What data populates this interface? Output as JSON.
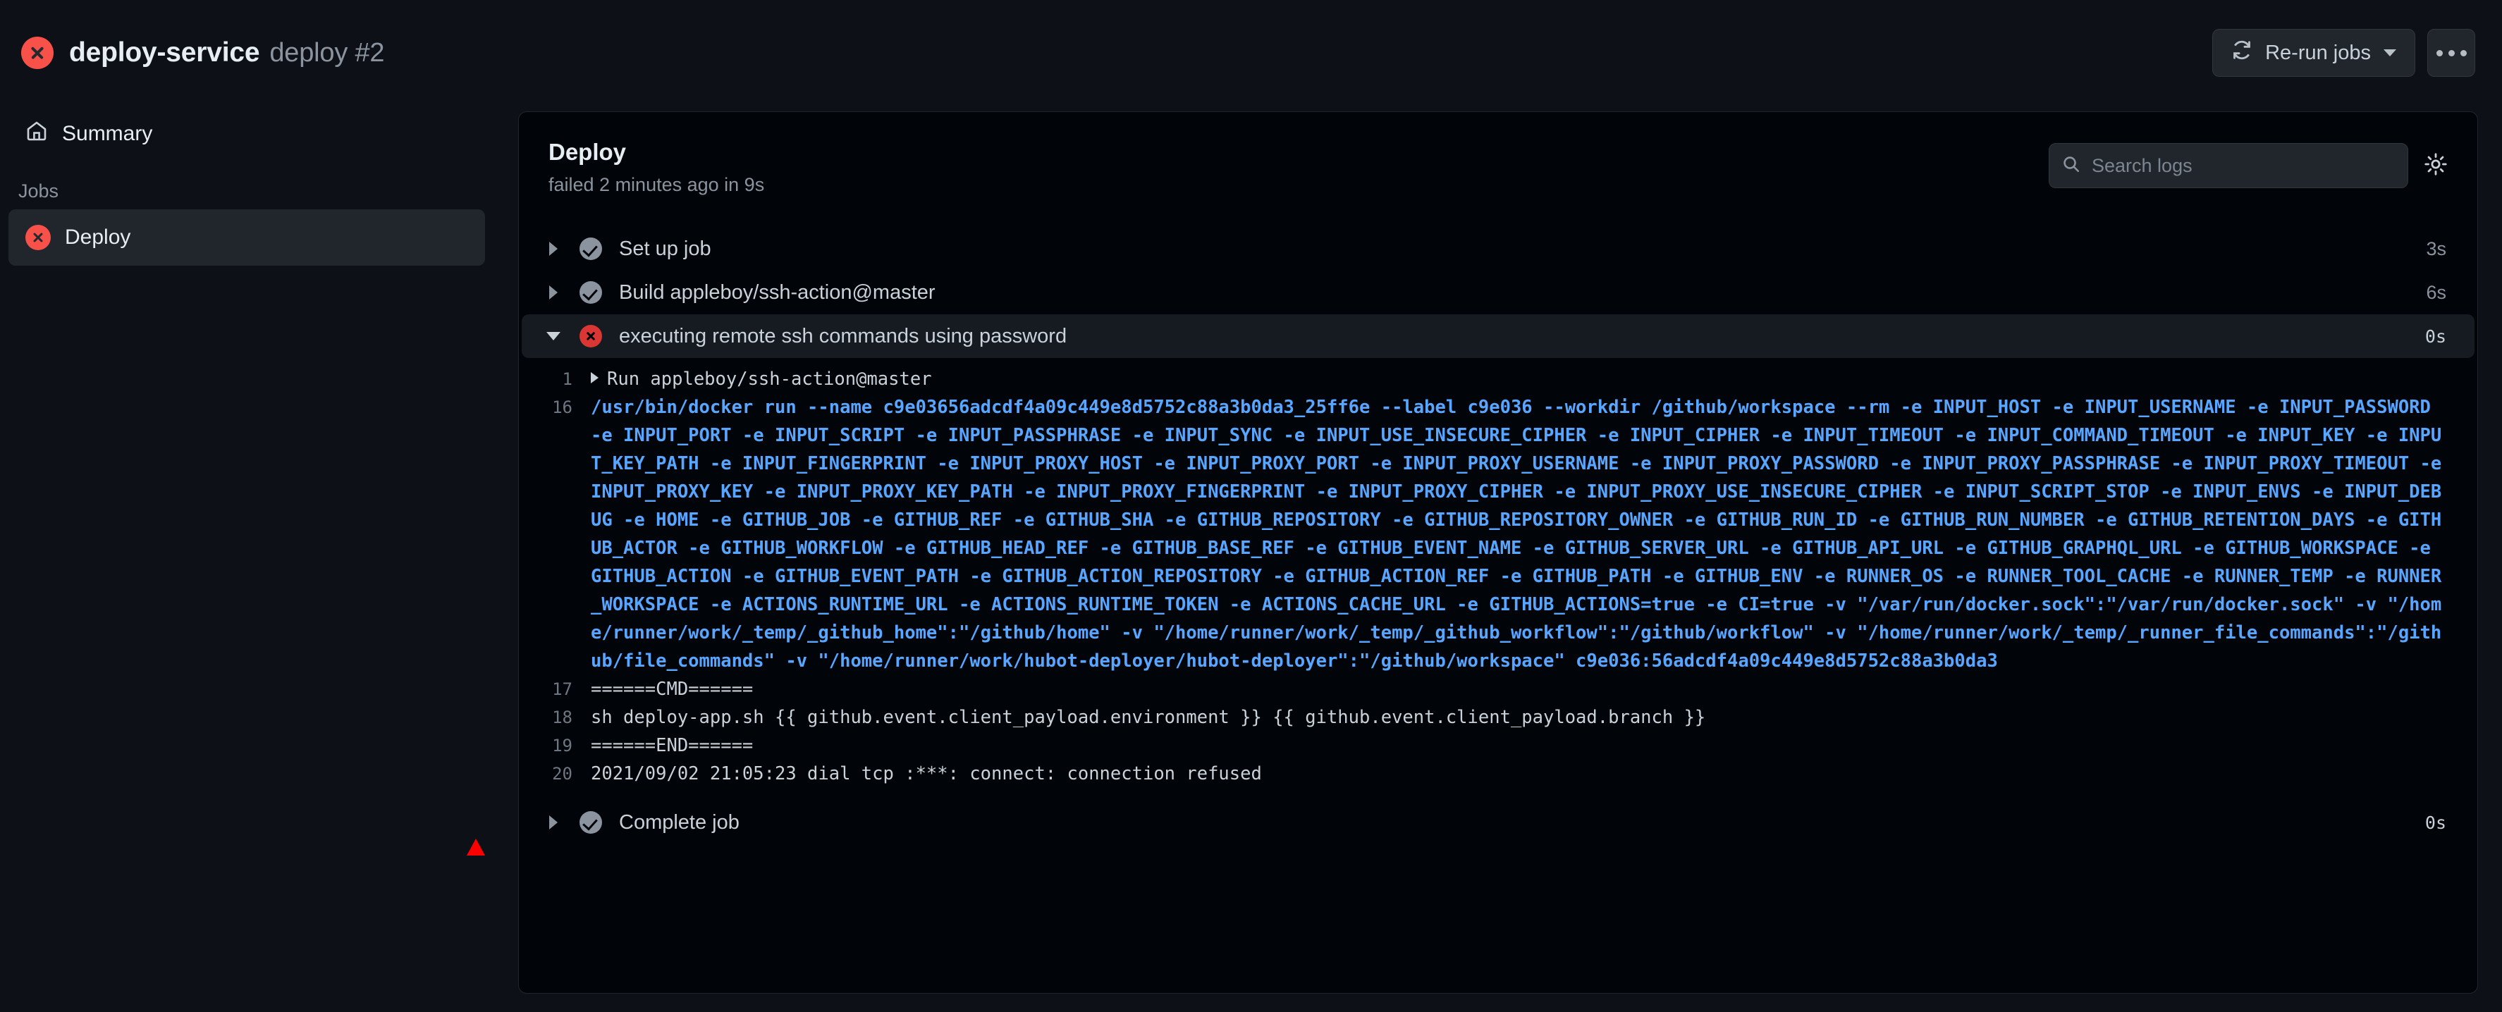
{
  "header": {
    "status_icon": "failure-x-icon",
    "workflow_name": "deploy-service",
    "run_label": "deploy #2",
    "rerun_button": "Re-run jobs",
    "rerun_icon": "refresh-icon",
    "more_button": "…",
    "accent_failure": "#f85149"
  },
  "sidebar": {
    "summary_label": "Summary",
    "summary_icon": "home-icon",
    "jobs_section_label": "Jobs",
    "jobs": [
      {
        "label": "Deploy",
        "status": "failure",
        "selected": true
      }
    ]
  },
  "panel": {
    "job_title": "Deploy",
    "job_status": "failed 2 minutes ago in 9s",
    "search": {
      "placeholder": "Search logs",
      "value": "",
      "icon": "search-icon"
    },
    "settings_icon": "gear-icon",
    "steps": [
      {
        "name": "Set up job",
        "status": "success",
        "duration": "3s",
        "expanded": false
      },
      {
        "name": "Build appleboy/ssh-action@master",
        "status": "success",
        "duration": "6s",
        "expanded": false
      },
      {
        "name": "executing remote ssh commands using password",
        "status": "failure",
        "duration": "0s",
        "expanded": true
      }
    ],
    "complete_step": {
      "name": "Complete job",
      "status": "success",
      "duration": "0s",
      "expanded": false
    },
    "log_lines": [
      {
        "n": "1",
        "style": "gray",
        "prefix": "run-triangle",
        "text": "Run appleboy/ssh-action@master"
      },
      {
        "n": "16",
        "style": "blue",
        "text": "/usr/bin/docker run --name c9e03656adcdf4a09c449e8d5752c88a3b0da3_25ff6e --label c9e036 --workdir /github/workspace --rm -e INPUT_HOST -e INPUT_USERNAME -e INPUT_PASSWORD -e INPUT_PORT -e INPUT_SCRIPT -e INPUT_PASSPHRASE -e INPUT_SYNC -e INPUT_USE_INSECURE_CIPHER -e INPUT_CIPHER -e INPUT_TIMEOUT -e INPUT_COMMAND_TIMEOUT -e INPUT_KEY -e INPUT_KEY_PATH -e INPUT_FINGERPRINT -e INPUT_PROXY_HOST -e INPUT_PROXY_PORT -e INPUT_PROXY_USERNAME -e INPUT_PROXY_PASSWORD -e INPUT_PROXY_PASSPHRASE -e INPUT_PROXY_TIMEOUT -e INPUT_PROXY_KEY -e INPUT_PROXY_KEY_PATH -e INPUT_PROXY_FINGERPRINT -e INPUT_PROXY_CIPHER -e INPUT_PROXY_USE_INSECURE_CIPHER -e INPUT_SCRIPT_STOP -e INPUT_ENVS -e INPUT_DEBUG -e HOME -e GITHUB_JOB -e GITHUB_REF -e GITHUB_SHA -e GITHUB_REPOSITORY -e GITHUB_REPOSITORY_OWNER -e GITHUB_RUN_ID -e GITHUB_RUN_NUMBER -e GITHUB_RETENTION_DAYS -e GITHUB_ACTOR -e GITHUB_WORKFLOW -e GITHUB_HEAD_REF -e GITHUB_BASE_REF -e GITHUB_EVENT_NAME -e GITHUB_SERVER_URL -e GITHUB_API_URL -e GITHUB_GRAPHQL_URL -e GITHUB_WORKSPACE -e GITHUB_ACTION -e GITHUB_EVENT_PATH -e GITHUB_ACTION_REPOSITORY -e GITHUB_ACTION_REF -e GITHUB_PATH -e GITHUB_ENV -e RUNNER_OS -e RUNNER_TOOL_CACHE -e RUNNER_TEMP -e RUNNER_WORKSPACE -e ACTIONS_RUNTIME_URL -e ACTIONS_RUNTIME_TOKEN -e ACTIONS_CACHE_URL -e GITHUB_ACTIONS=true -e CI=true -v \"/var/run/docker.sock\":\"/var/run/docker.sock\" -v \"/home/runner/work/_temp/_github_home\":\"/github/home\" -v \"/home/runner/work/_temp/_github_workflow\":\"/github/workflow\" -v \"/home/runner/work/_temp/_runner_file_commands\":\"/github/file_commands\" -v \"/home/runner/work/hubot-deployer/hubot-deployer\":\"/github/workspace\" c9e036:56adcdf4a09c449e8d5752c88a3b0da3"
      },
      {
        "n": "17",
        "style": "gray",
        "text": "======CMD======"
      },
      {
        "n": "18",
        "style": "gray",
        "text": "sh deploy-app.sh {{ github.event.client_payload.environment }} {{ github.event.client_payload.branch }}"
      },
      {
        "n": "19",
        "style": "gray",
        "text": "======END======"
      },
      {
        "n": "20",
        "style": "gray",
        "text": "2021/09/02 21:05:23 dial tcp :***: connect: connection refused"
      }
    ]
  },
  "marker": {
    "shape": "red-triangle",
    "color": "#ff0000"
  }
}
